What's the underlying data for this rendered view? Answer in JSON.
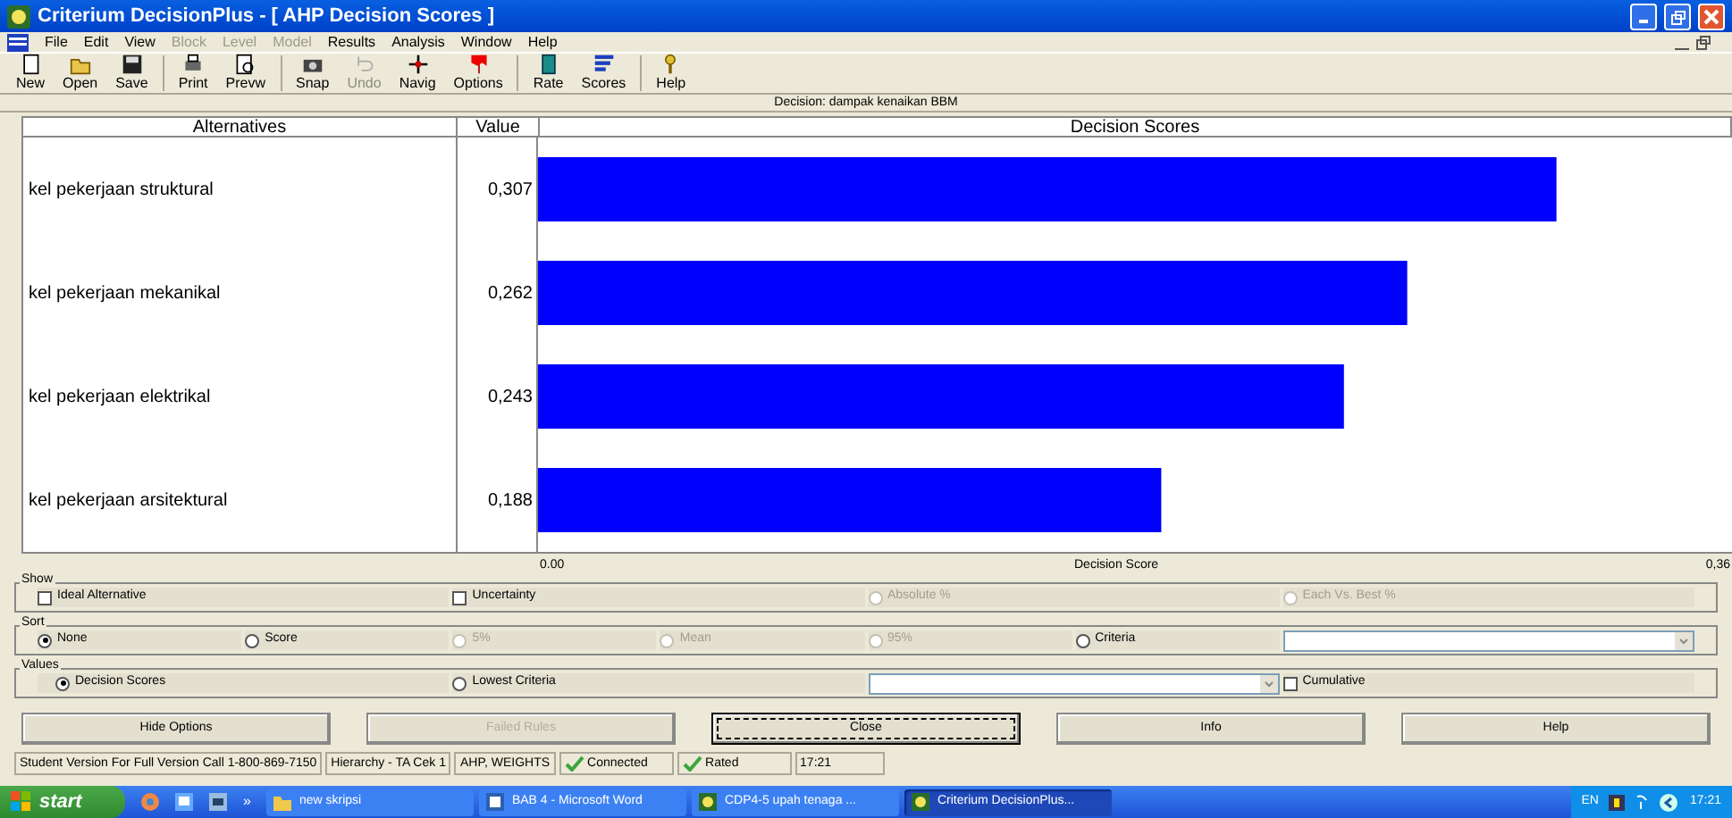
{
  "window": {
    "title": "Criterium DecisionPlus - [ AHP Decision Scores ]"
  },
  "menu": [
    {
      "label": "File",
      "disabled": false
    },
    {
      "label": "Edit",
      "disabled": false
    },
    {
      "label": "View",
      "disabled": false
    },
    {
      "label": "Block",
      "disabled": true
    },
    {
      "label": "Level",
      "disabled": true
    },
    {
      "label": "Model",
      "disabled": true
    },
    {
      "label": "Results",
      "disabled": false
    },
    {
      "label": "Analysis",
      "disabled": false
    },
    {
      "label": "Window",
      "disabled": false
    },
    {
      "label": "Help",
      "disabled": false
    }
  ],
  "toolbar": [
    {
      "label": "New",
      "disabled": false
    },
    {
      "label": "Open",
      "disabled": false
    },
    {
      "label": "Save",
      "disabled": false
    },
    {
      "label": "Print",
      "disabled": false
    },
    {
      "label": "Prevw",
      "disabled": false
    },
    {
      "label": "Snap",
      "disabled": false
    },
    {
      "label": "Undo",
      "disabled": true
    },
    {
      "label": "Navig",
      "disabled": false
    },
    {
      "label": "Options",
      "disabled": false
    },
    {
      "label": "Rate",
      "disabled": false
    },
    {
      "label": "Scores",
      "disabled": false
    },
    {
      "label": "Help",
      "disabled": false
    }
  ],
  "decision_label": "Decision: dampak kenaikan BBM",
  "table": {
    "columns": [
      "Alternatives",
      "Value",
      "Decision Scores"
    ],
    "rows": [
      {
        "alternative": "kel pekerjaan struktural",
        "value": "0,307",
        "level": 0.853
      },
      {
        "alternative": "kel pekerjaan mekanikal",
        "value": "0,262",
        "level": 0.728
      },
      {
        "alternative": "kel pekerjaan elektrikal",
        "value": "0,243",
        "level": 0.675
      },
      {
        "alternative": "kel pekerjaan arsitektural",
        "value": "0,188",
        "level": 0.522
      }
    ],
    "axis_title": "Decision Score",
    "axis_labels": [
      "0.00",
      "0,36"
    ]
  },
  "options": [
    {
      "title": "Show",
      "items": [
        {
          "kind": "checkbox",
          "label": "Ideal Alternative",
          "checked": false,
          "disabled": false
        },
        {
          "kind": "checkbox",
          "label": "Uncertainty",
          "checked": false,
          "disabled": false
        },
        {
          "kind": "radio",
          "label": "Absolute %",
          "selected": false,
          "disabled": true
        },
        {
          "kind": "radio",
          "label": "Each Vs. Best %",
          "selected": false,
          "disabled": true
        }
      ]
    },
    {
      "title": "Sort",
      "items": [
        {
          "kind": "radio",
          "label": "None",
          "selected": true,
          "disabled": false
        },
        {
          "kind": "radio",
          "label": "Score",
          "selected": false,
          "disabled": false
        },
        {
          "kind": "radio",
          "label": "5%",
          "selected": false,
          "disabled": true
        },
        {
          "kind": "radio",
          "label": "Mean",
          "selected": false,
          "disabled": true
        },
        {
          "kind": "radio",
          "label": "95%",
          "selected": false,
          "disabled": true
        },
        {
          "kind": "radio",
          "label": "Criteria",
          "selected": false,
          "disabled": false
        },
        {
          "kind": "dropdown"
        }
      ]
    },
    {
      "title": "Values",
      "items": [
        {
          "kind": "radio",
          "label": "Decision Scores",
          "selected": true,
          "disabled": false
        },
        {
          "kind": "radio",
          "label": "Lowest Criteria",
          "selected": false,
          "disabled": false
        },
        {
          "kind": "dropdown"
        },
        {
          "kind": "checkbox",
          "label": "Cumulative",
          "checked": false,
          "disabled": false
        }
      ]
    }
  ],
  "buttons": [
    {
      "label": "Hide Options",
      "disabled": false,
      "focused": false
    },
    {
      "label": "Failed Rules",
      "disabled": true,
      "focused": false
    },
    {
      "label": "Close",
      "disabled": false,
      "focused": true
    },
    {
      "label": "Info",
      "disabled": false,
      "focused": false
    },
    {
      "label": "Help",
      "disabled": false,
      "focused": false
    }
  ],
  "status_bar": [
    {
      "text": "Student Version For Full Version Call 1-800-869-7150",
      "check": false
    },
    {
      "text": "Hierarchy - TA Cek 1",
      "check": false
    },
    {
      "text": "AHP, WEIGHTS",
      "check": false
    },
    {
      "text": "Connected",
      "check": true
    },
    {
      "text": "Rated",
      "check": true
    },
    {
      "text": "17:21",
      "check": false
    }
  ],
  "taskbar": {
    "start": "start",
    "overflow": "»",
    "tasks": [
      {
        "label": "new skripsi",
        "selected": false
      },
      {
        "label": "BAB 4 - Microsoft Word",
        "selected": false
      },
      {
        "label": "CDP4-5 upah tenaga ...",
        "selected": false
      },
      {
        "label": "Criterium DecisionPlus...",
        "selected": true
      }
    ],
    "language": "EN",
    "clock": "17:21"
  }
}
